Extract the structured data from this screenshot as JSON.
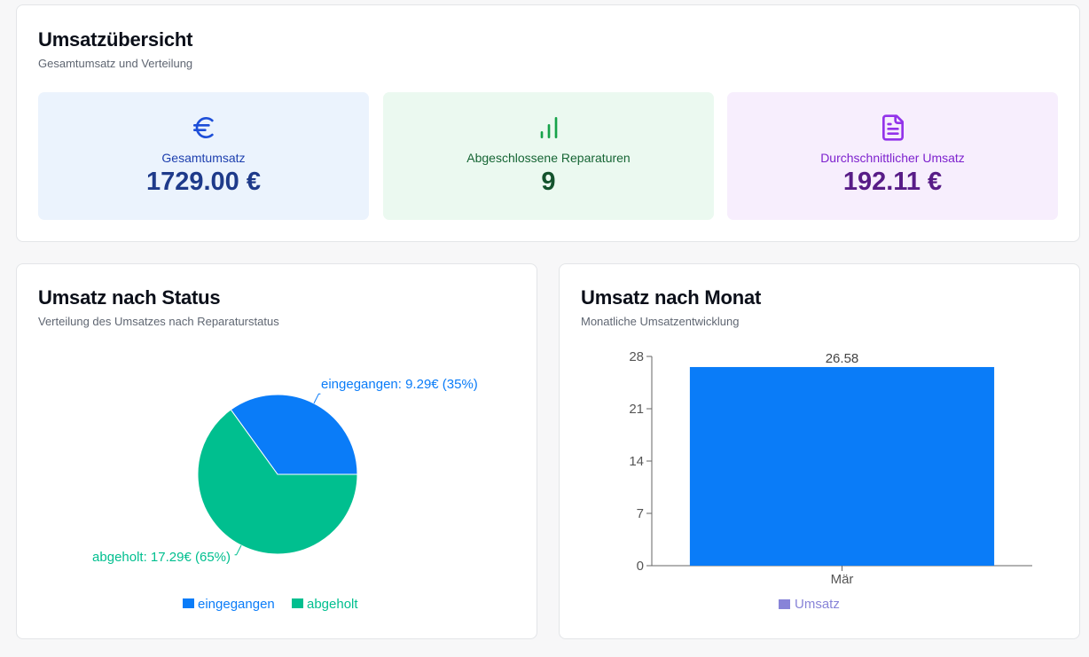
{
  "overview": {
    "title": "Umsatzübersicht",
    "subtitle": "Gesamtumsatz und Verteilung",
    "stats": [
      {
        "icon": "euro-icon",
        "label": "Gesamtumsatz",
        "value": "1729.00 €",
        "color": "#1d4ed8"
      },
      {
        "icon": "bar-chart-icon",
        "label": "Abgeschlossene Reparaturen",
        "value": "9",
        "color": "#16a34a"
      },
      {
        "icon": "document-icon",
        "label": "Durchschnittlicher Umsatz",
        "value": "192.11 €",
        "color": "#9333ea"
      }
    ]
  },
  "status_card": {
    "title": "Umsatz nach Status",
    "subtitle": "Verteilung des Umsatzes nach Reparaturstatus"
  },
  "month_card": {
    "title": "Umsatz nach Monat",
    "subtitle": "Monatliche Umsatzentwicklung"
  },
  "chart_data": [
    {
      "type": "pie",
      "slices": [
        {
          "name": "eingegangen",
          "value": 9.29,
          "percent": 35,
          "label": "eingegangen: 9.29€ (35%)",
          "color": "#0a7cf8"
        },
        {
          "name": "abgeholt",
          "value": 17.29,
          "percent": 65,
          "label": "abgeholt: 17.29€ (65%)",
          "color": "#00bf8f"
        }
      ],
      "legend": {
        "position": "bottom",
        "entries": [
          "eingegangen",
          "abgeholt"
        ]
      }
    },
    {
      "type": "bar",
      "categories": [
        "Mär"
      ],
      "series": [
        {
          "name": "Umsatz",
          "values": [
            26.58
          ],
          "color": "#0a7cf8"
        }
      ],
      "data_labels": [
        "26.58"
      ],
      "yticks": [
        "0",
        "7",
        "14",
        "21",
        "28"
      ],
      "ylim": [
        0,
        28
      ],
      "legend": {
        "position": "bottom",
        "entries": [
          "Umsatz"
        ],
        "color": "#8884d8"
      }
    }
  ]
}
